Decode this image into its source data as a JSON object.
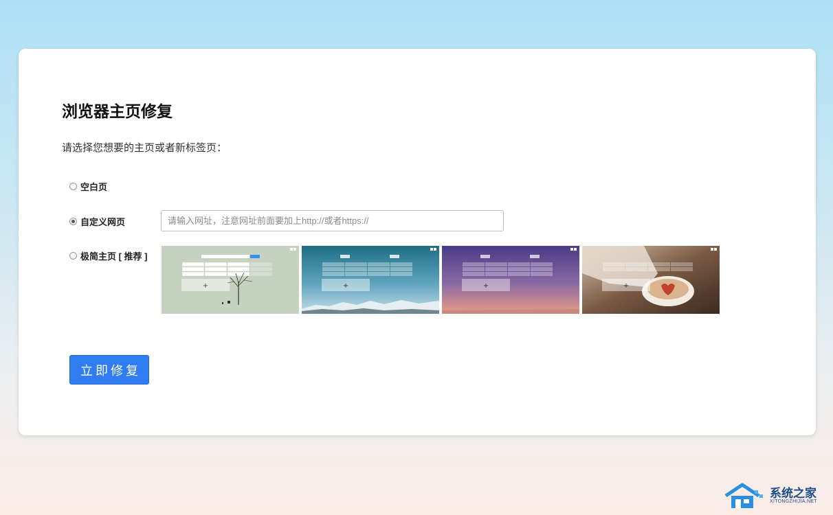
{
  "page": {
    "title": "浏览器主页修复",
    "subtitle": "请选择您想要的主页或者新标签页："
  },
  "options": {
    "blank": {
      "label": "空白页",
      "selected": false
    },
    "custom": {
      "label": "自定义网页",
      "selected": true,
      "input_value": "",
      "input_placeholder": "请输入网址，注意网址前面要加上http://或者https://"
    },
    "minimal": {
      "label": "极简主页 [ 推荐 ]",
      "selected": false
    }
  },
  "themes": [
    {
      "name": "tree",
      "plus": "+"
    },
    {
      "name": "snow-mountain",
      "plus": "+"
    },
    {
      "name": "purple-sunset",
      "plus": "+"
    },
    {
      "name": "coffee",
      "plus": "+"
    }
  ],
  "action": {
    "fix_label": "立即修复"
  },
  "watermark": {
    "name": "系统之家",
    "domain": "XITONGZHIJIA.NET"
  },
  "colors": {
    "accent": "#2f7cf3",
    "bg_top": "#ade0f5",
    "bg_bottom": "#fbece7"
  }
}
